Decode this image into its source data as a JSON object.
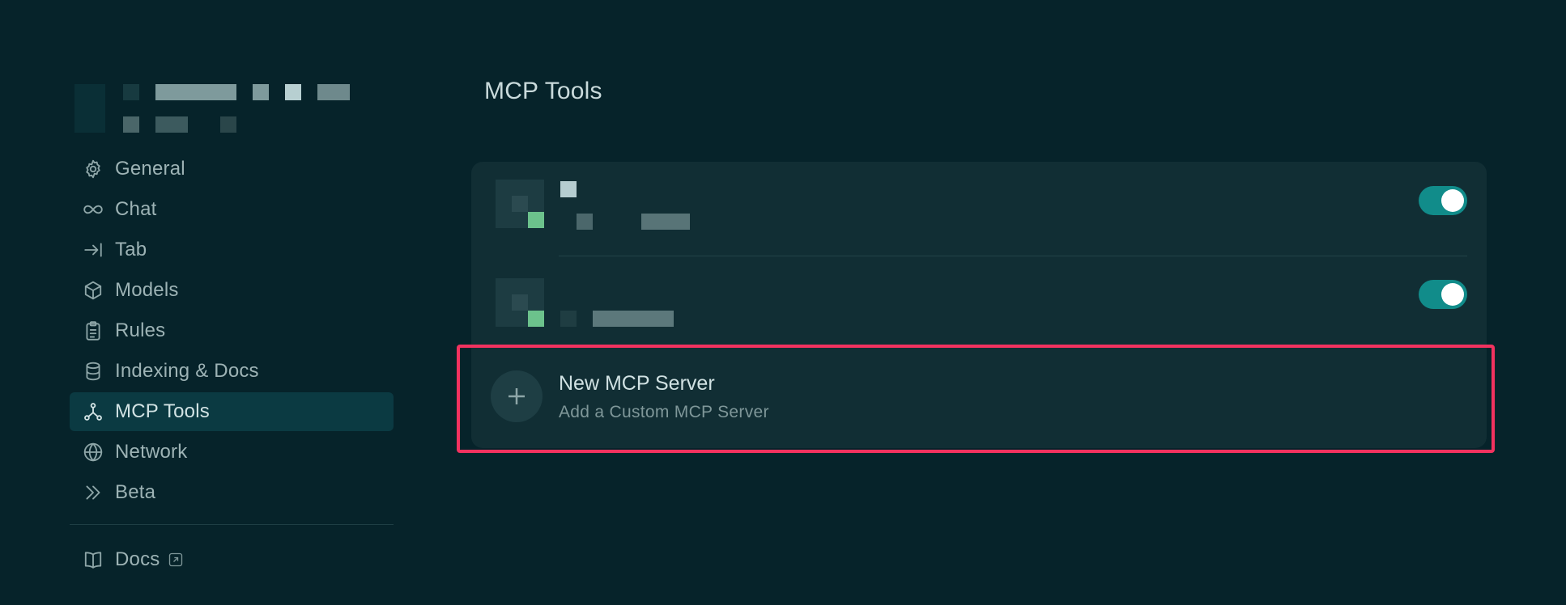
{
  "sidebar": {
    "items": [
      {
        "label": "General",
        "icon": "gear-icon"
      },
      {
        "label": "Chat",
        "icon": "infinity-icon"
      },
      {
        "label": "Tab",
        "icon": "tab-arrow-icon"
      },
      {
        "label": "Models",
        "icon": "cube-icon"
      },
      {
        "label": "Rules",
        "icon": "clipboard-icon"
      },
      {
        "label": "Indexing & Docs",
        "icon": "database-icon"
      },
      {
        "label": "MCP Tools",
        "icon": "mcp-node-icon",
        "active": true
      },
      {
        "label": "Network",
        "icon": "globe-icon"
      },
      {
        "label": "Beta",
        "icon": "double-chevron-icon"
      }
    ],
    "docs_label": "Docs"
  },
  "main": {
    "title": "MCP Tools",
    "servers": [
      {
        "enabled": true
      },
      {
        "enabled": true
      }
    ],
    "new_server": {
      "title": "New MCP Server",
      "subtitle": "Add a Custom MCP Server"
    }
  },
  "colors": {
    "background": "#06232a",
    "card": "#112e34",
    "toggle_on": "#118c8a",
    "highlight": "#f2325f",
    "active_nav": "#0b3a42"
  }
}
